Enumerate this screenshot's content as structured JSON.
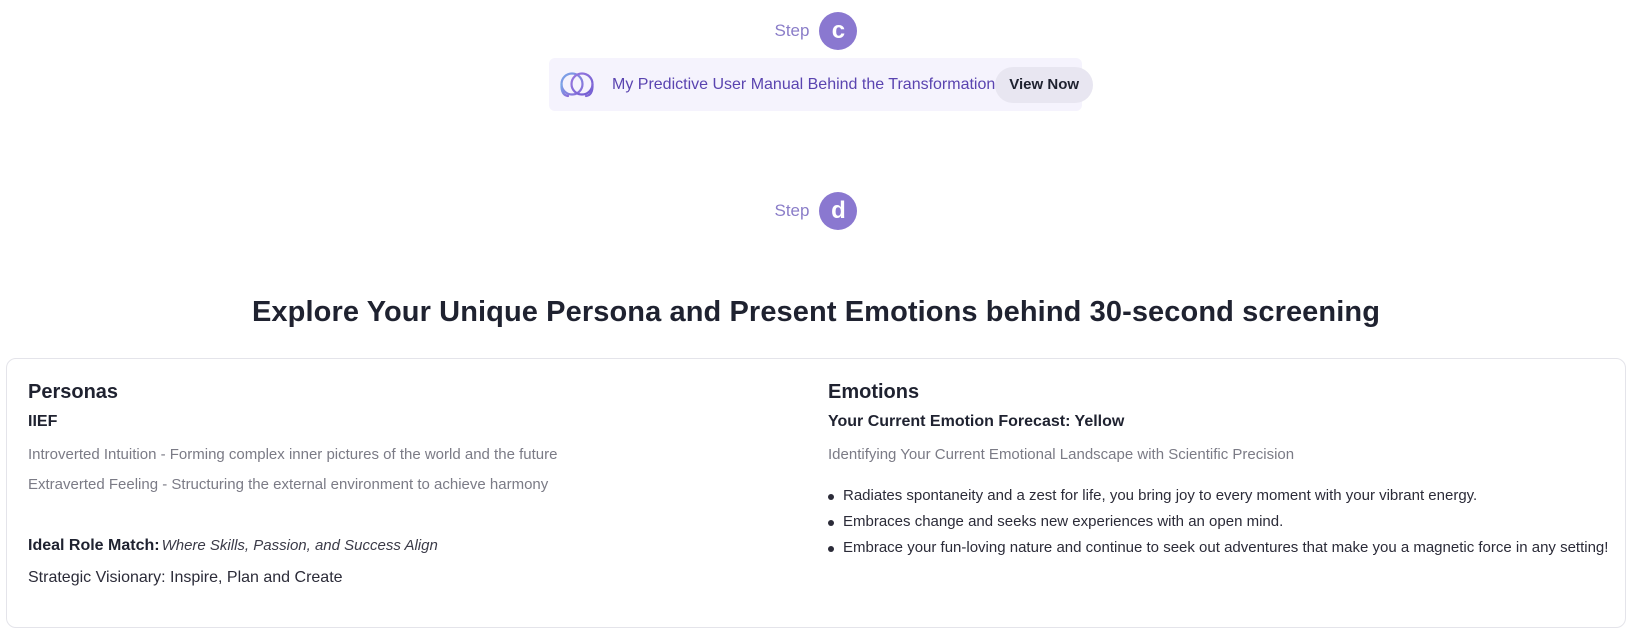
{
  "step_c": {
    "label": "Step",
    "badge": "c"
  },
  "banner": {
    "text": "My Predictive User Manual Behind the Transformation",
    "button": "View Now",
    "icon": "overlapping-circles-icon"
  },
  "step_d": {
    "label": "Step",
    "badge": "d"
  },
  "explore_title": "Explore Your Unique Persona and Present Emotions behind 30-second screening",
  "personas": {
    "title": "Personas",
    "type_code": "IIEF",
    "traits": [
      "Introverted Intuition - Forming complex inner pictures of the world and the future",
      "Extraverted Feeling - Structuring the external environment to achieve harmony"
    ],
    "role_label": "Ideal Role Match:",
    "role_tagline": "Where Skills, Passion, and Success Align",
    "role_value": "Strategic Visionary: Inspire, Plan and Create"
  },
  "emotions": {
    "title": "Emotions",
    "forecast": "Your Current Emotion Forecast: Yellow",
    "description": "Identifying Your Current Emotional Landscape with Scientific Precision",
    "bullets": [
      "Radiates spontaneity and a zest for life, you bring joy to every moment with your vibrant energy.",
      "Embraces change and seeks new experiences with an open mind.",
      "Embrace your fun-loving nature and continue to seek out adventures that make you a magnetic force in any setting!"
    ]
  },
  "colors": {
    "accent": "#8a78d0",
    "banner_bg": "#f5f3fd",
    "banner_text": "#5a44b0",
    "button_bg": "#e8e6f1"
  }
}
